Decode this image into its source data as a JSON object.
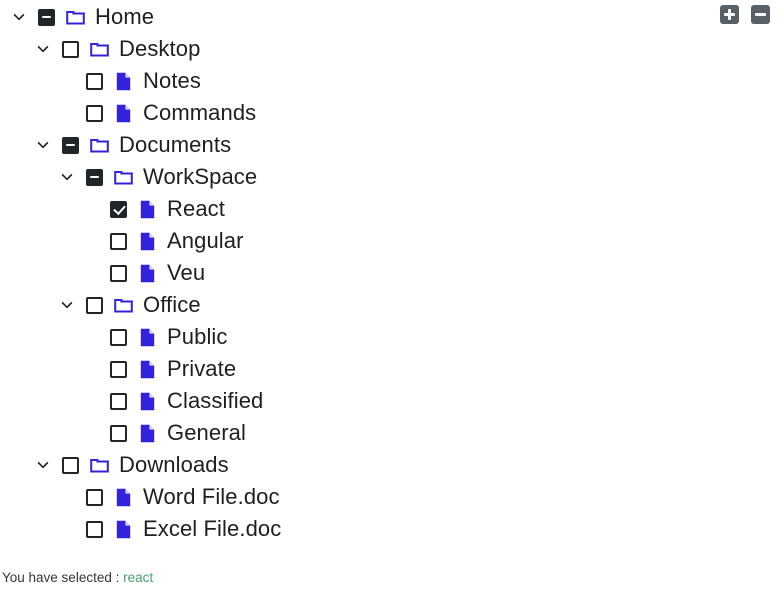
{
  "toolbar": {
    "expand_all_label": "+",
    "collapse_all_label": "-",
    "expand_all_name": "expand-all",
    "collapse_all_name": "collapse-all"
  },
  "colors": {
    "icon_blue": "#3323dc",
    "checkbox_dark": "#212529",
    "label": "#1c1f23",
    "status_value_green": "#47a06d",
    "button_gray": "#5a6068",
    "background": "#ffffff"
  },
  "tree": {
    "nodes": [
      {
        "label": "Home",
        "level": 0,
        "type": "folder",
        "expandable": true,
        "expanded": true,
        "check": "indeterminate"
      },
      {
        "label": "Desktop",
        "level": 1,
        "type": "folder",
        "expandable": true,
        "expanded": true,
        "check": "unchecked"
      },
      {
        "label": "Notes",
        "level": 2,
        "type": "file",
        "expandable": false,
        "expanded": false,
        "check": "unchecked"
      },
      {
        "label": "Commands",
        "level": 2,
        "type": "file",
        "expandable": false,
        "expanded": false,
        "check": "unchecked"
      },
      {
        "label": "Documents",
        "level": 1,
        "type": "folder",
        "expandable": true,
        "expanded": true,
        "check": "indeterminate"
      },
      {
        "label": "WorkSpace",
        "level": 2,
        "type": "folder",
        "expandable": true,
        "expanded": true,
        "check": "indeterminate"
      },
      {
        "label": "React",
        "level": 3,
        "type": "file",
        "expandable": false,
        "expanded": false,
        "check": "checked"
      },
      {
        "label": "Angular",
        "level": 3,
        "type": "file",
        "expandable": false,
        "expanded": false,
        "check": "unchecked"
      },
      {
        "label": "Veu",
        "level": 3,
        "type": "file",
        "expandable": false,
        "expanded": false,
        "check": "unchecked"
      },
      {
        "label": "Office",
        "level": 2,
        "type": "folder",
        "expandable": true,
        "expanded": true,
        "check": "unchecked"
      },
      {
        "label": "Public",
        "level": 3,
        "type": "file",
        "expandable": false,
        "expanded": false,
        "check": "unchecked"
      },
      {
        "label": "Private",
        "level": 3,
        "type": "file",
        "expandable": false,
        "expanded": false,
        "check": "unchecked"
      },
      {
        "label": "Classified",
        "level": 3,
        "type": "file",
        "expandable": false,
        "expanded": false,
        "check": "unchecked"
      },
      {
        "label": "General",
        "level": 3,
        "type": "file",
        "expandable": false,
        "expanded": false,
        "check": "unchecked"
      },
      {
        "label": "Downloads",
        "level": 1,
        "type": "folder",
        "expandable": true,
        "expanded": true,
        "check": "unchecked"
      },
      {
        "label": "Word File.doc",
        "level": 2,
        "type": "file",
        "expandable": false,
        "expanded": false,
        "check": "unchecked"
      },
      {
        "label": "Excel File.doc",
        "level": 2,
        "type": "file",
        "expandable": false,
        "expanded": false,
        "check": "unchecked"
      }
    ]
  },
  "status": {
    "prefix": "You have selected : ",
    "value": "react"
  }
}
